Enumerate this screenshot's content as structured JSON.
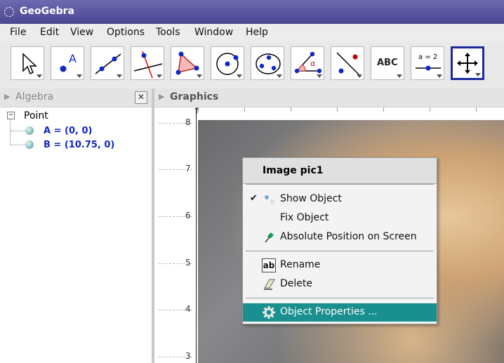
{
  "window": {
    "title": "GeoGebra"
  },
  "menu": [
    "File",
    "Edit",
    "View",
    "Options",
    "Tools",
    "Window",
    "Help"
  ],
  "toolbar": {
    "tools": [
      {
        "name": "move-tool",
        "icon": "cursor-arrow-icon"
      },
      {
        "name": "new-point-tool",
        "icon": "point-icon",
        "label": "A"
      },
      {
        "name": "line-tool",
        "icon": "line-icon"
      },
      {
        "name": "perpendicular-line-tool",
        "icon": "perpendicular-icon"
      },
      {
        "name": "polygon-tool",
        "icon": "polygon-icon"
      },
      {
        "name": "circle-tool",
        "icon": "circle-icon"
      },
      {
        "name": "conic-tool",
        "icon": "conic-icon"
      },
      {
        "name": "angle-tool",
        "icon": "angle-icon",
        "label": "α"
      },
      {
        "name": "reflect-tool",
        "icon": "reflect-icon"
      },
      {
        "name": "text-tool",
        "icon": "text-icon",
        "label": "ABC"
      },
      {
        "name": "slider-tool",
        "icon": "slider-icon",
        "label": "a = 2"
      },
      {
        "name": "move-graphics-view-tool",
        "icon": "move-view-icon",
        "selected": true
      }
    ]
  },
  "algebra": {
    "title": "Algebra",
    "group": "Point",
    "items": [
      {
        "label": "A = (0, 0)"
      },
      {
        "label": "B = (10.75, 0)"
      }
    ]
  },
  "graphics": {
    "title": "Graphics",
    "y_ticks": [
      "8",
      "7",
      "6",
      "5",
      "4",
      "3"
    ],
    "image_name": "pic1"
  },
  "context_menu": {
    "title": "Image pic1",
    "items": [
      {
        "label": "Show Object",
        "checked": true,
        "icon": "show-object-icon"
      },
      {
        "label": "Fix Object",
        "icon": ""
      },
      {
        "label": "Absolute Position on Screen",
        "icon": "pin-icon"
      },
      {
        "label": "Rename",
        "icon": "rename-icon"
      },
      {
        "label": "Delete",
        "icon": "eraser-icon"
      },
      {
        "label": "Object Properties ...",
        "icon": "gear-icon",
        "highlighted": true
      }
    ]
  },
  "colors": {
    "accent": "#1a8f8f",
    "titlebar": "#4a4690",
    "point_blue": "#1028c8",
    "point_red": "#c00000"
  }
}
